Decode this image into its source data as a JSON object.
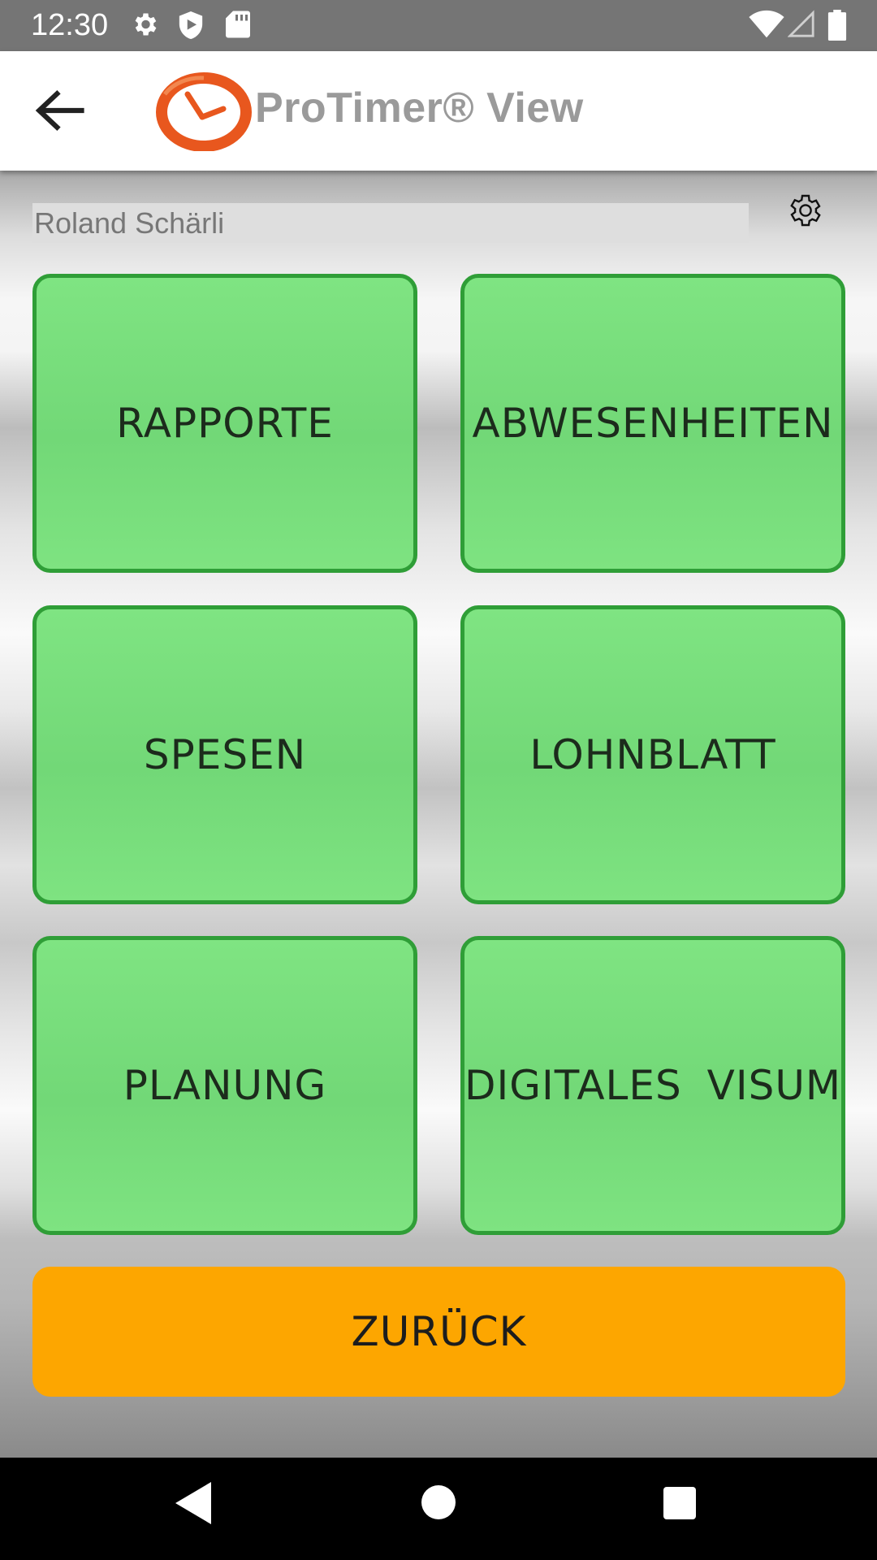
{
  "status_bar": {
    "time": "12:30",
    "left_icons": [
      "gear-icon",
      "shield-icon",
      "sd-card-icon"
    ],
    "right_icons": [
      "wifi-icon",
      "signal-icon",
      "battery-icon"
    ]
  },
  "app_bar": {
    "title": "ProTimer® View",
    "logo_icon": "protimer-clock-logo",
    "back_icon": "arrow-left-icon"
  },
  "user": {
    "name": "Roland Schärli"
  },
  "menu": {
    "items": [
      {
        "label": "RAPPORTE"
      },
      {
        "label": "ABWESENHEITEN"
      },
      {
        "label": "SPESEN"
      },
      {
        "label": "LOHNBLATT"
      },
      {
        "label": "PLANUNG"
      },
      {
        "label": "DIGITALES VISUM"
      }
    ],
    "tile_color": "#78dc7c",
    "tile_border_color": "#2f9e37"
  },
  "back_button": {
    "label": "ZURÜCK",
    "color": "#fda600"
  },
  "nav_bar": {
    "icons": [
      "nav-back-icon",
      "nav-home-icon",
      "nav-recents-icon"
    ]
  }
}
